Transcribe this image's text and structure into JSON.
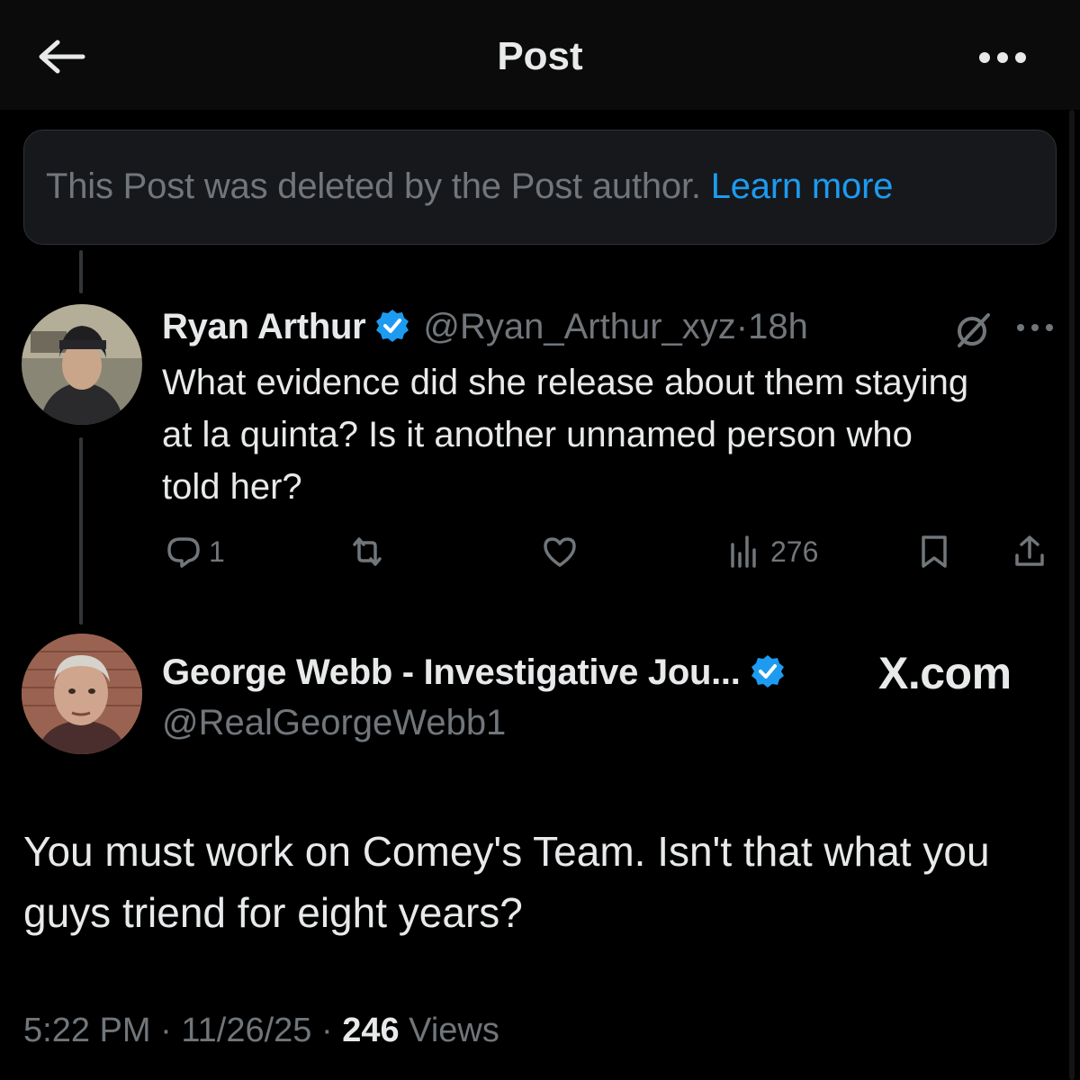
{
  "header": {
    "title": "Post"
  },
  "deleted_notice": {
    "text": "This Post was deleted by the Post author.",
    "link": "Learn more"
  },
  "reply": {
    "name": "Ryan Arthur",
    "handle": "@Ryan_Arthur_xyz",
    "separator": "·",
    "time": "18h",
    "text": "What evidence did she release about them staying at la quinta? Is it another unnamed person who told her?",
    "reply_count": "1",
    "views_count": "276"
  },
  "main_post": {
    "name": "George Webb - Investigative Jou...",
    "handle": "@RealGeorgeWebb1",
    "watermark": "X.com",
    "text": "You must work on Comey's Team. Isn't that what you guys triend for eight years?",
    "time": "5:22 PM",
    "date": "11/26/25",
    "views_count": "246",
    "views_label": "Views",
    "separator": "·"
  },
  "colors": {
    "background": "#000000",
    "text_primary": "#e7e9ea",
    "text_secondary": "#71767b",
    "accent": "#1d9bf0"
  }
}
